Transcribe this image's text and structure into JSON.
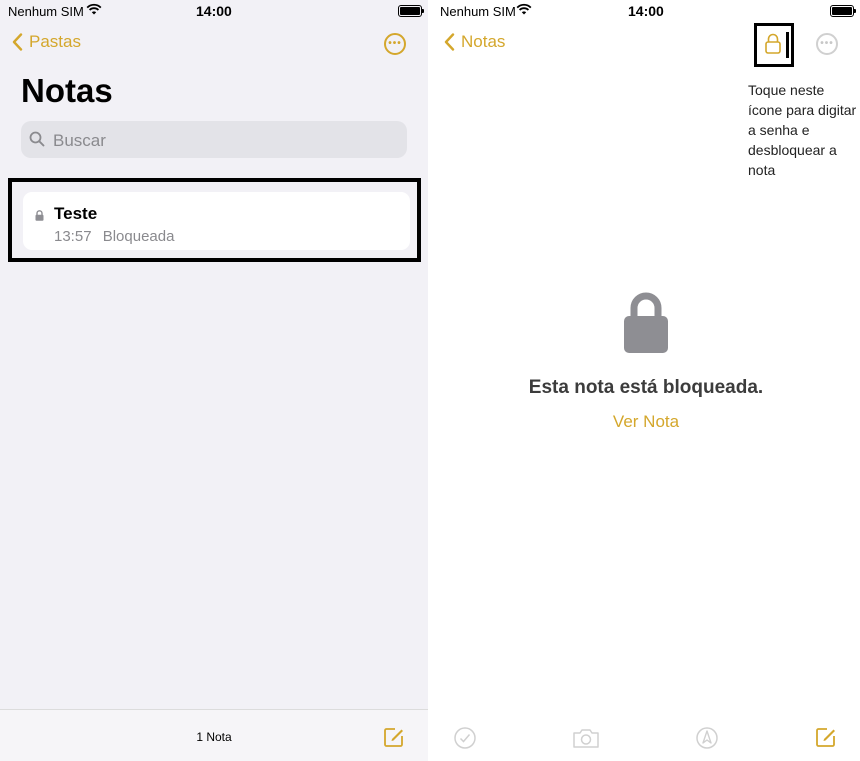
{
  "left": {
    "status": {
      "carrier": "Nenhum SIM",
      "time": "14:00"
    },
    "nav": {
      "back_label": "Pastas"
    },
    "title": "Notas",
    "search": {
      "placeholder": "Buscar"
    },
    "notes": [
      {
        "title": "Teste",
        "time": "13:57",
        "status": "Bloqueada",
        "locked": true
      }
    ],
    "footer": {
      "count": "1 Nota"
    }
  },
  "right": {
    "status": {
      "carrier": "Nenhum SIM",
      "time": "14:00"
    },
    "nav": {
      "back_label": "Notas"
    },
    "hint": "Toque neste ícone para digitar a senha e desbloquear a nota",
    "locked_message": "Esta nota está bloqueada.",
    "view_label": "Ver Nota"
  },
  "colors": {
    "accent": "#d4a72c",
    "background_list": "#f2f1f6",
    "lock_gray": "#8e8e93"
  },
  "icons": [
    "wifi-icon",
    "battery-icon",
    "chevron-left-icon",
    "ellipsis-circle-icon",
    "search-icon",
    "lock-icon",
    "compose-icon",
    "checklist-icon",
    "camera-icon",
    "markup-icon"
  ]
}
